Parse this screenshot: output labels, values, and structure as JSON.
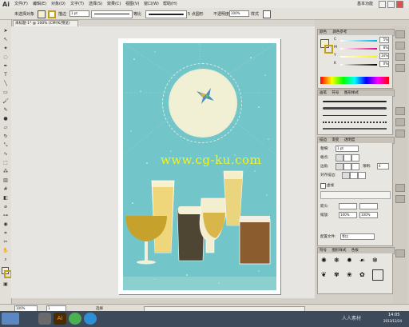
{
  "app": {
    "logo": "Ai",
    "workspace": "基本功能"
  },
  "menu": {
    "items": [
      "文件(F)",
      "编辑(E)",
      "对象(O)",
      "文字(T)",
      "选择(S)",
      "效果(C)",
      "视图(V)",
      "窗口(W)",
      "帮助(H)"
    ]
  },
  "control": {
    "no_selection": "未选择对象",
    "stroke_label": "描边",
    "stroke_value": "1 pt",
    "profile_label": "等比",
    "brush_value": "5 点圆形",
    "opacity_label": "不透明度",
    "opacity_value": "100%",
    "style_label": "样式"
  },
  "document": {
    "tab_title": "未标题-1* @ 100% (CMYK/预览)",
    "zoom": "100%",
    "page": "1"
  },
  "tools": [
    "selection-icon",
    "direct-selection-icon",
    "magic-wand-icon",
    "lasso-icon",
    "pen-icon",
    "type-icon",
    "line-icon",
    "rectangle-icon",
    "paintbrush-icon",
    "pencil-icon",
    "blob-brush-icon",
    "eraser-icon",
    "rotate-icon",
    "scale-icon",
    "warp-icon",
    "free-transform-icon",
    "symbol-sprayer-icon",
    "graph-icon",
    "mesh-icon",
    "gradient-icon",
    "eyedropper-icon",
    "blend-icon",
    "live-paint-icon",
    "slice-icon",
    "scissors-icon",
    "hand-icon",
    "zoom-icon",
    "fill-stroke-icon",
    "screen-mode-icon"
  ],
  "artwork": {
    "watermark": "www.cg-ku.com",
    "background_color": "#72c5c8",
    "moon_color": "#f2f0d4"
  },
  "color_panel": {
    "tabs": [
      "颜色",
      "颜色参考"
    ],
    "channels": [
      {
        "label": "C",
        "value": "5%"
      },
      {
        "label": "M",
        "value": "8%"
      },
      {
        "label": "Y",
        "value": "34%"
      },
      {
        "label": "K",
        "value": "0%"
      }
    ]
  },
  "brushes_panel": {
    "tabs": [
      "画笔",
      "符号",
      "图形样式"
    ]
  },
  "stroke_panel": {
    "tabs": [
      "描边",
      "渐变",
      "透明度"
    ],
    "weight_label": "粗细:",
    "weight_value": "1 pt",
    "cap_label": "端点:",
    "join_label": "边角:",
    "limit_label": "限制:",
    "limit_value": "4",
    "align_label": "对齐描边:",
    "dashed_label": "虚线",
    "arrow_label": "箭头:",
    "scale_label": "缩放:",
    "scale_value": "100%",
    "profile_label": "配置文件:",
    "profile_value": "等比"
  },
  "symbols_panel": {
    "tabs": [
      "符号",
      "图形样式",
      "色板"
    ]
  },
  "statusbar": {
    "zoom": "100%",
    "page": "1",
    "tool": "选择"
  },
  "taskbar": {
    "time": "14:05",
    "date": "2013/12/24",
    "badge": "人人素材",
    "app_ai": "Ai"
  }
}
